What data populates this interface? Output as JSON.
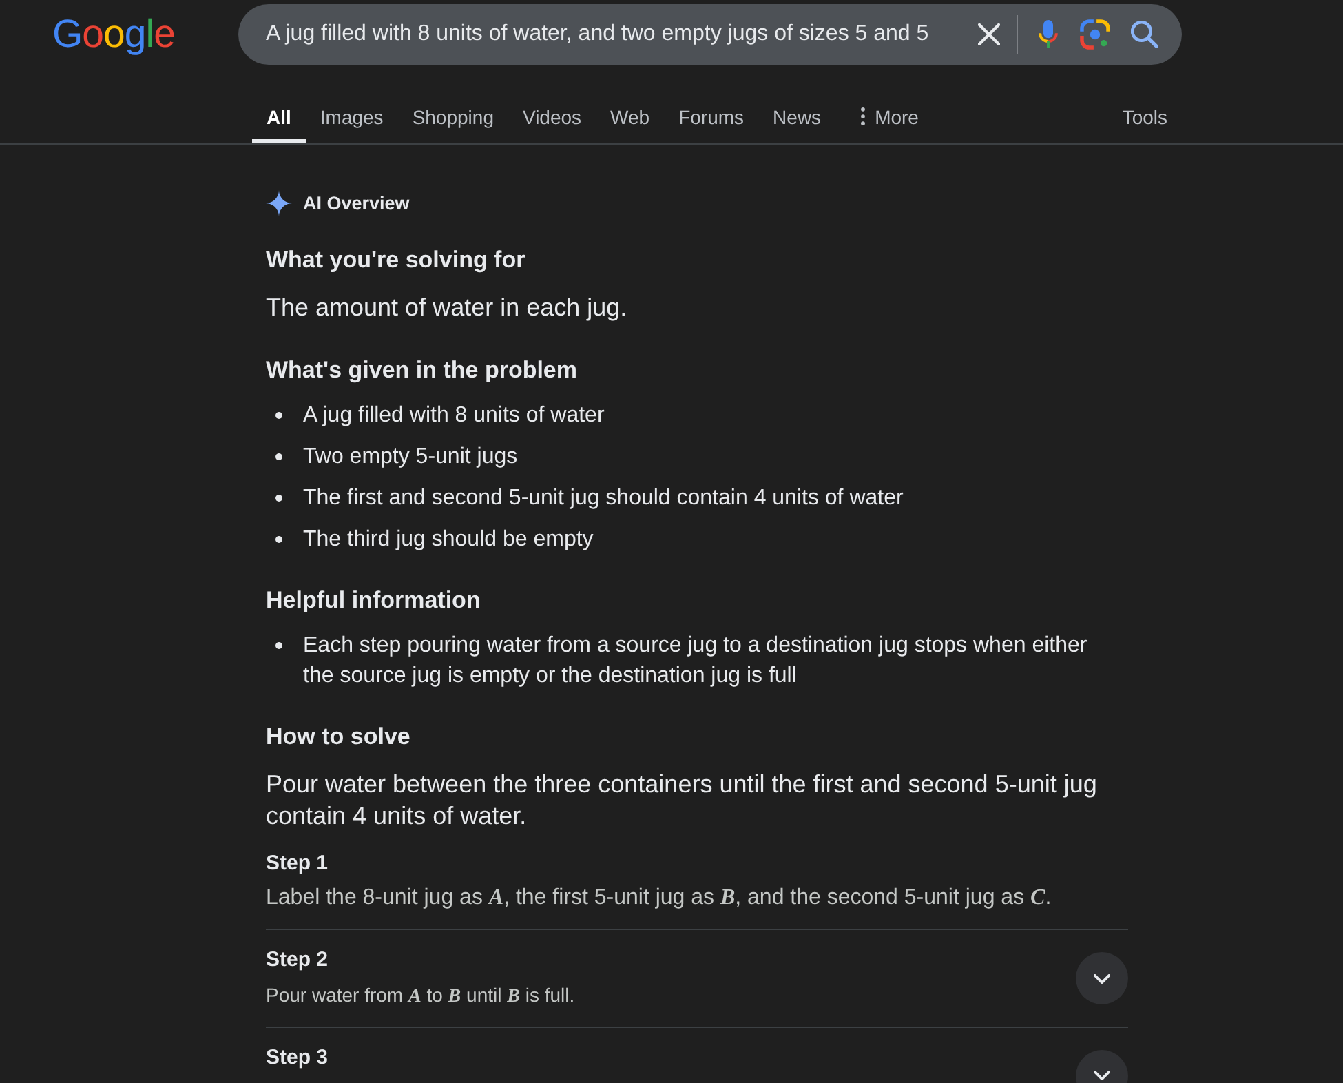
{
  "logo": "Google",
  "search": {
    "value": "A jug filled with 8 units of water, and two empty jugs of sizes 5 and 5"
  },
  "tabs": [
    {
      "label": "All",
      "selected": true,
      "kind": "plain"
    },
    {
      "label": "Images",
      "selected": false,
      "kind": "plain"
    },
    {
      "label": "Shopping",
      "selected": false,
      "kind": "plain"
    },
    {
      "label": "Videos",
      "selected": false,
      "kind": "plain"
    },
    {
      "label": "Web",
      "selected": false,
      "kind": "plain"
    },
    {
      "label": "Forums",
      "selected": false,
      "kind": "plain"
    },
    {
      "label": "News",
      "selected": false,
      "kind": "plain"
    },
    {
      "label": "More",
      "selected": false,
      "kind": "menu"
    }
  ],
  "tools": "Tools",
  "ai_overview": {
    "title": "AI Overview",
    "sections": [
      {
        "heading": "What you're solving for",
        "kind": "paragraph",
        "text": "The amount of water in each jug."
      },
      {
        "heading": "What's given in the problem",
        "kind": "list",
        "items": [
          "A jug filled with 8 units of water",
          "Two empty 5-unit jugs",
          "The first and second 5-unit jug should contain 4 units of water",
          "The third jug should be empty"
        ]
      },
      {
        "heading": "Helpful information",
        "kind": "list",
        "items": [
          "Each step pouring water from a source jug to a destination jug stops when either the source jug is empty or the destination jug is full"
        ]
      },
      {
        "heading": "How to solve",
        "kind": "paragraph",
        "text": "Pour water between the three containers until the first and second 5-unit jug contain 4 units of water."
      }
    ],
    "steps": [
      {
        "title": "Step 1",
        "text": "Label the 8-unit jug as *A*, the first 5-unit jug as *B*, and the second 5-unit jug as *C*.",
        "expandable": false
      },
      {
        "title": "Step 2",
        "text": "Pour water from *A* to *B* until *B* is full.",
        "expandable": true
      },
      {
        "title": "Step 3",
        "expandable": true
      }
    ]
  }
}
